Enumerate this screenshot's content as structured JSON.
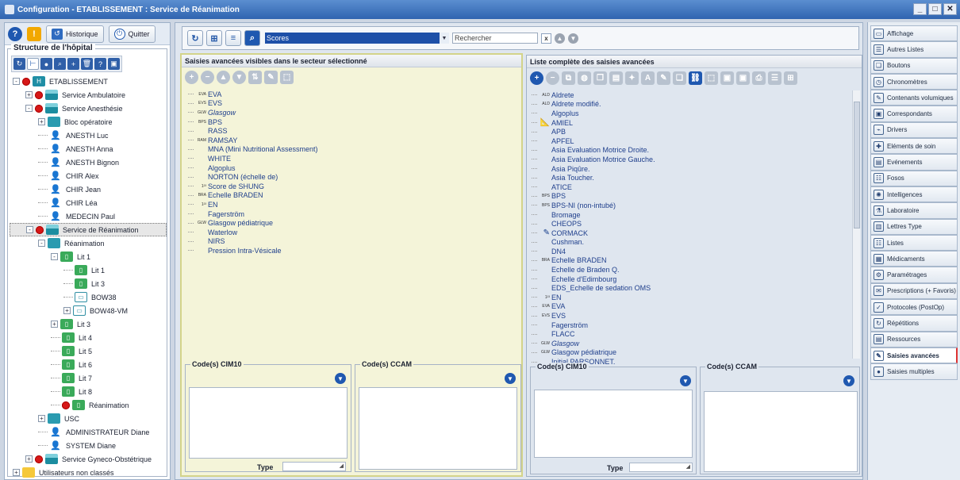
{
  "window": {
    "title": "Configuration - ETABLISSEMENT : Service de Réanimation"
  },
  "left": {
    "historique": "Historique",
    "quitter": "Quitter",
    "structure_title": "Structure de l'hôpital",
    "tree": [
      {
        "label": "ETABLISSEMENT",
        "icon": "estab-icon",
        "indent": 0,
        "exp": "-",
        "gear": true
      },
      {
        "label": "Service Ambulatoire",
        "icon": "service-icon",
        "indent": 1,
        "exp": "+",
        "gear": true
      },
      {
        "label": "Service Anesthésie",
        "icon": "service-icon",
        "indent": 1,
        "exp": "-",
        "gear": true
      },
      {
        "label": "Bloc opératoire",
        "icon": "bloc-icon",
        "indent": 2,
        "exp": "+",
        "gear": false
      },
      {
        "label": "ANESTH Luc",
        "icon": "user-icon",
        "indent": 2,
        "exp": "",
        "gear": false
      },
      {
        "label": "ANESTH Anna",
        "icon": "user-icon",
        "indent": 2,
        "exp": "",
        "gear": false
      },
      {
        "label": "ANESTH Bignon",
        "icon": "user-icon",
        "indent": 2,
        "exp": "",
        "gear": false
      },
      {
        "label": "CHIR Alex",
        "icon": "user-icon",
        "indent": 2,
        "exp": "",
        "gear": false
      },
      {
        "label": "CHIR Jean",
        "icon": "user-icon",
        "indent": 2,
        "exp": "",
        "gear": false
      },
      {
        "label": "CHIR Léa",
        "icon": "user-icon",
        "indent": 2,
        "exp": "",
        "gear": false
      },
      {
        "label": "MEDECIN Paul",
        "icon": "user-icon",
        "indent": 2,
        "exp": "",
        "gear": false
      },
      {
        "label": "Service de Réanimation",
        "icon": "service-icon",
        "indent": 1,
        "exp": "-",
        "gear": true,
        "selected": true
      },
      {
        "label": "Réanimation",
        "icon": "bloc-icon",
        "indent": 2,
        "exp": "-",
        "gear": false
      },
      {
        "label": "Lit 1",
        "icon": "bed-icon",
        "indent": 3,
        "exp": "-",
        "gear": false
      },
      {
        "label": "Lit 1",
        "icon": "bed-icon",
        "indent": 4,
        "exp": "",
        "gear": false
      },
      {
        "label": "Lit 3",
        "icon": "bed-icon",
        "indent": 4,
        "exp": "",
        "gear": false
      },
      {
        "label": "BOW38",
        "icon": "bow-icon",
        "indent": 4,
        "exp": "",
        "gear": false
      },
      {
        "label": "BOW48-VM",
        "icon": "bow-icon",
        "indent": 4,
        "exp": "+",
        "gear": false
      },
      {
        "label": "Lit 3",
        "icon": "bed-icon",
        "indent": 3,
        "exp": "+",
        "gear": false
      },
      {
        "label": "Lit 4",
        "icon": "bed-icon",
        "indent": 3,
        "exp": "",
        "gear": false
      },
      {
        "label": "Lit 5",
        "icon": "bed-icon",
        "indent": 3,
        "exp": "",
        "gear": false
      },
      {
        "label": "Lit 6",
        "icon": "bed-icon",
        "indent": 3,
        "exp": "",
        "gear": false
      },
      {
        "label": "Lit 7",
        "icon": "bed-icon",
        "indent": 3,
        "exp": "",
        "gear": false
      },
      {
        "label": "Lit 8",
        "icon": "bed-icon",
        "indent": 3,
        "exp": "",
        "gear": false
      },
      {
        "label": "Réanimation",
        "icon": "bed-icon",
        "indent": 3,
        "exp": "",
        "gear": true
      },
      {
        "label": "USC",
        "icon": "bloc-icon",
        "indent": 2,
        "exp": "+",
        "gear": false
      },
      {
        "label": "ADMINISTRATEUR Diane",
        "icon": "user-icon",
        "indent": 2,
        "exp": "",
        "gear": false
      },
      {
        "label": "SYSTEM Diane",
        "icon": "user-icon",
        "indent": 2,
        "exp": "",
        "gear": false
      },
      {
        "label": "Service Gyneco-Obstétrique",
        "icon": "service-icon",
        "indent": 1,
        "exp": "+",
        "gear": true
      },
      {
        "label": "Utilisateurs non classés",
        "icon": "folder-icon",
        "indent": 0,
        "exp": "+",
        "gear": false
      }
    ]
  },
  "topbar": {
    "scores_value": "Scores",
    "search_placeholder": "Rechercher",
    "clear": "x"
  },
  "visible_panel": {
    "title": "Saisies avancées visibles dans le secteur sélectionné",
    "items": [
      {
        "pre": "EVA",
        "label": "EVA"
      },
      {
        "pre": "EVS",
        "label": "EVS"
      },
      {
        "pre": "GLW",
        "label": "Glasgow",
        "italic": true
      },
      {
        "pre": "BPS",
        "label": "BPS"
      },
      {
        "pre": "",
        "label": "RASS"
      },
      {
        "pre": "RAM",
        "label": "RAMSAY"
      },
      {
        "pre": "",
        "label": "MNA (Mini Nutritional Assessment)"
      },
      {
        "pre": "",
        "label": "WHITE"
      },
      {
        "pre": "",
        "label": "Algoplus"
      },
      {
        "pre": "",
        "label": "NORTON (échelle de)"
      },
      {
        "pre": "1²³",
        "label": "Score de SHUNG"
      },
      {
        "pre": "BRA",
        "label": "Echelle BRADEN"
      },
      {
        "pre": "1²³",
        "label": "EN"
      },
      {
        "pre": "",
        "label": "Fagerström"
      },
      {
        "pre": "GLW",
        "label": "Glasgow pédiatrique"
      },
      {
        "pre": "",
        "label": "Waterlow"
      },
      {
        "pre": "",
        "label": "NIRS"
      },
      {
        "pre": "",
        "label": "Pression Intra-Vésicale"
      }
    ],
    "cim10": "Code(s) CIM10",
    "ccam": "Code(s) CCAM",
    "type": "Type"
  },
  "full_panel": {
    "title": "Liste complète des saisies avancées",
    "items": [
      {
        "pre": "ALD",
        "label": "Aldrete"
      },
      {
        "pre": "ALD",
        "label": "Aldrete modifié."
      },
      {
        "pre": "",
        "label": "Algoplus"
      },
      {
        "pre": "",
        "label": "AMIEL",
        "pen": "ruler"
      },
      {
        "pre": "",
        "label": "APB"
      },
      {
        "pre": "",
        "label": "APFEL"
      },
      {
        "pre": "",
        "label": "Asia Evaluation Motrice Droite."
      },
      {
        "pre": "",
        "label": "Asia Evaluation Motrice Gauche."
      },
      {
        "pre": "",
        "label": "Asia Piqûre."
      },
      {
        "pre": "",
        "label": "Asia Toucher."
      },
      {
        "pre": "",
        "label": "ATICE"
      },
      {
        "pre": "BPS",
        "label": "BPS"
      },
      {
        "pre": "BPS",
        "label": "BPS-NI (non-intubé)"
      },
      {
        "pre": "",
        "label": "Bromage"
      },
      {
        "pre": "",
        "label": "CHEOPS"
      },
      {
        "pre": "",
        "label": "CORMACK",
        "pen": "pen"
      },
      {
        "pre": "",
        "label": "Cushman."
      },
      {
        "pre": "",
        "label": "DN4"
      },
      {
        "pre": "BRA",
        "label": "Echelle BRADEN"
      },
      {
        "pre": "",
        "label": "Echelle de Braden Q."
      },
      {
        "pre": "",
        "label": "Echelle d'Edimbourg"
      },
      {
        "pre": "",
        "label": "EDS_Echelle de sedation OMS"
      },
      {
        "pre": "1²³",
        "label": "EN"
      },
      {
        "pre": "EVA",
        "label": "EVA"
      },
      {
        "pre": "EVS",
        "label": "EVS"
      },
      {
        "pre": "",
        "label": "Fagerström"
      },
      {
        "pre": "",
        "label": "FLACC"
      },
      {
        "pre": "GLW",
        "label": "Glasgow",
        "italic": true
      },
      {
        "pre": "GLW",
        "label": "Glasgow pédiatrique"
      },
      {
        "pre": "",
        "label": "Initial PARSONNET."
      }
    ],
    "cim10": "Code(s) CIM10",
    "ccam": "Code(s) CCAM",
    "type": "Type"
  },
  "right_menu": [
    {
      "label": "Affichage",
      "icon": "display-icon"
    },
    {
      "label": "Autres Listes",
      "icon": "list-icon"
    },
    {
      "label": "Boutons",
      "icon": "buttons-icon"
    },
    {
      "label": "Chronomètres",
      "icon": "clock-icon"
    },
    {
      "label": "Contenants volumiques",
      "icon": "syringe-icon"
    },
    {
      "label": "Correspondants",
      "icon": "contact-icon"
    },
    {
      "label": "Drivers",
      "icon": "driver-icon"
    },
    {
      "label": "Eléments de soin",
      "icon": "care-icon"
    },
    {
      "label": "Evénements",
      "icon": "events-icon"
    },
    {
      "label": "Fosos",
      "icon": "fosos-icon"
    },
    {
      "label": "Intelligences",
      "icon": "intel-icon"
    },
    {
      "label": "Laboratoire",
      "icon": "lab-icon"
    },
    {
      "label": "Lettres Type",
      "icon": "letters-icon"
    },
    {
      "label": "Listes",
      "icon": "lists-icon"
    },
    {
      "label": "Médicaments",
      "icon": "meds-icon"
    },
    {
      "label": "Paramétrages",
      "icon": "settings-icon"
    },
    {
      "label": "Prescriptions (+ Favoris)",
      "icon": "prescription-icon"
    },
    {
      "label": "Protocoles (PostOp)",
      "icon": "protocol-icon"
    },
    {
      "label": "Répétitions",
      "icon": "repeat-icon"
    },
    {
      "label": "Ressources",
      "icon": "resources-icon"
    },
    {
      "label": "Saisies avancées",
      "icon": "advanced-icon",
      "active": true
    },
    {
      "label": "Saisies multiples",
      "icon": "multiple-icon"
    }
  ],
  "colors": {
    "title_blue": "#2f64b0",
    "panel_yellow": "#f4f4d9",
    "panel_right": "#dfe6ef",
    "accent": "#1f58b0",
    "gear_red": "#d61818"
  }
}
